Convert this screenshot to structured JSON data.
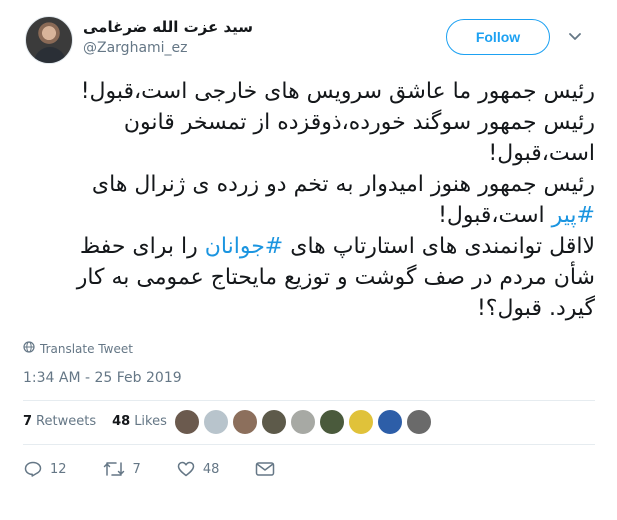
{
  "user": {
    "display_name": "سید عزت الله ضرغامی",
    "handle": "@Zarghami_ez",
    "follow_label": "Follow"
  },
  "tweet": {
    "lines": [
      {
        "parts": [
          {
            "text": "رئیس جمهور ما عاشق سرویس های خارجی است،قبول!",
            "hashtag": false
          }
        ]
      },
      {
        "parts": [
          {
            "text": "رئیس جمهور سوگند خورده،ذوقزده از تمسخر قانون",
            "hashtag": false
          }
        ]
      },
      {
        "parts": [
          {
            "text": "است،قبول!",
            "hashtag": false
          }
        ]
      },
      {
        "parts": [
          {
            "text": "رئیس جمهور هنوز امیدوار به تخم دو زرده ی ژنرال های",
            "hashtag": false
          }
        ]
      },
      {
        "parts": [
          {
            "text": "#پیر",
            "hashtag": true
          },
          {
            "text": " است،قبول!",
            "hashtag": false
          }
        ]
      },
      {
        "parts": [
          {
            "text": "لااقل توانمندی های استارتاپ های ",
            "hashtag": false
          },
          {
            "text": "#جوانان",
            "hashtag": true
          },
          {
            "text": " را برای حفظ",
            "hashtag": false
          }
        ]
      },
      {
        "parts": [
          {
            "text": "شأن مردم در صف گوشت و توزیع مایحتاج عمومی به کار",
            "hashtag": false
          }
        ]
      },
      {
        "parts": [
          {
            "text": "گیرد. قبول؟!",
            "hashtag": false
          }
        ]
      }
    ],
    "translate_label": "Translate Tweet",
    "timestamp": "1:34 AM - 25 Feb 2019"
  },
  "stats": {
    "retweets_count": "7",
    "retweets_label": "Retweets",
    "likes_count": "48",
    "likes_label": "Likes"
  },
  "likers": [
    {
      "name": "liker-avatar-1",
      "color": "#6b5a4e"
    },
    {
      "name": "liker-avatar-2",
      "color": "#b8c4cc"
    },
    {
      "name": "liker-avatar-3",
      "color": "#8c6f5c"
    },
    {
      "name": "liker-avatar-4",
      "color": "#5d5a4a"
    },
    {
      "name": "liker-avatar-5",
      "color": "#a7a9a4"
    },
    {
      "name": "liker-avatar-6",
      "color": "#4a5a3c"
    },
    {
      "name": "liker-avatar-7",
      "color": "#e0c23a"
    },
    {
      "name": "liker-avatar-8",
      "color": "#2d5ea8"
    },
    {
      "name": "liker-avatar-9",
      "color": "#6a6a6a"
    }
  ],
  "actions": {
    "reply_count": "12",
    "retweet_count": "7",
    "like_count": "48"
  },
  "colors": {
    "accent": "#1da1f2",
    "hashtag": "#1b95e0",
    "muted": "#657786",
    "text": "#14171a",
    "divider": "#e6ecf0"
  },
  "icons": [
    "chevron-down-icon",
    "globe-icon",
    "reply-icon",
    "retweet-icon",
    "heart-icon",
    "message-icon"
  ]
}
